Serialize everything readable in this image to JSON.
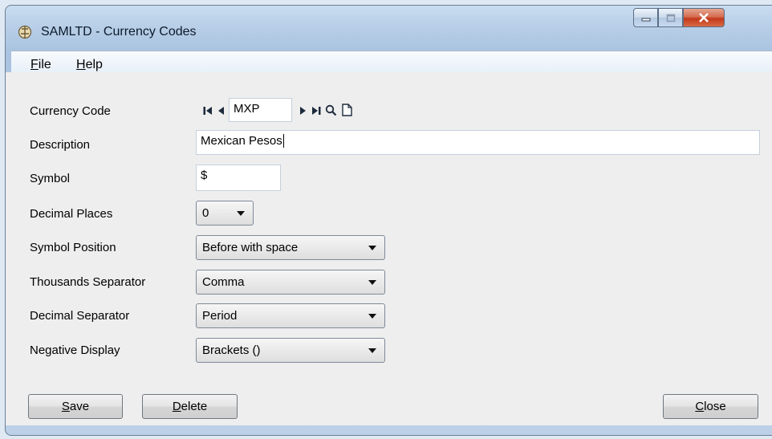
{
  "window": {
    "title": "SAMLTD - Currency Codes"
  },
  "menu": {
    "file": "File",
    "help": "Help"
  },
  "form": {
    "currency_code": {
      "label": "Currency Code",
      "value": "MXP"
    },
    "description": {
      "label": "Description",
      "value": "Mexican Pesos"
    },
    "symbol": {
      "label": "Symbol",
      "value": "$"
    },
    "decimal_places": {
      "label": "Decimal Places",
      "value": "0"
    },
    "symbol_position": {
      "label": "Symbol Position",
      "value": "Before with space"
    },
    "thousands_separator": {
      "label": "Thousands Separator",
      "value": "Comma"
    },
    "decimal_separator": {
      "label": "Decimal Separator",
      "value": "Period"
    },
    "negative_display": {
      "label": "Negative Display",
      "value": "Brackets ()"
    }
  },
  "buttons": {
    "save": {
      "first": "S",
      "rest": "ave"
    },
    "delete": {
      "first": "D",
      "rest": "elete"
    },
    "close": {
      "first": "C",
      "rest": "lose"
    }
  },
  "icons": [
    "app-icon",
    "first-record-icon",
    "previous-record-icon",
    "next-record-icon",
    "last-record-icon",
    "search-icon",
    "new-record-icon",
    "minimize-icon",
    "maximize-icon",
    "close-icon"
  ]
}
